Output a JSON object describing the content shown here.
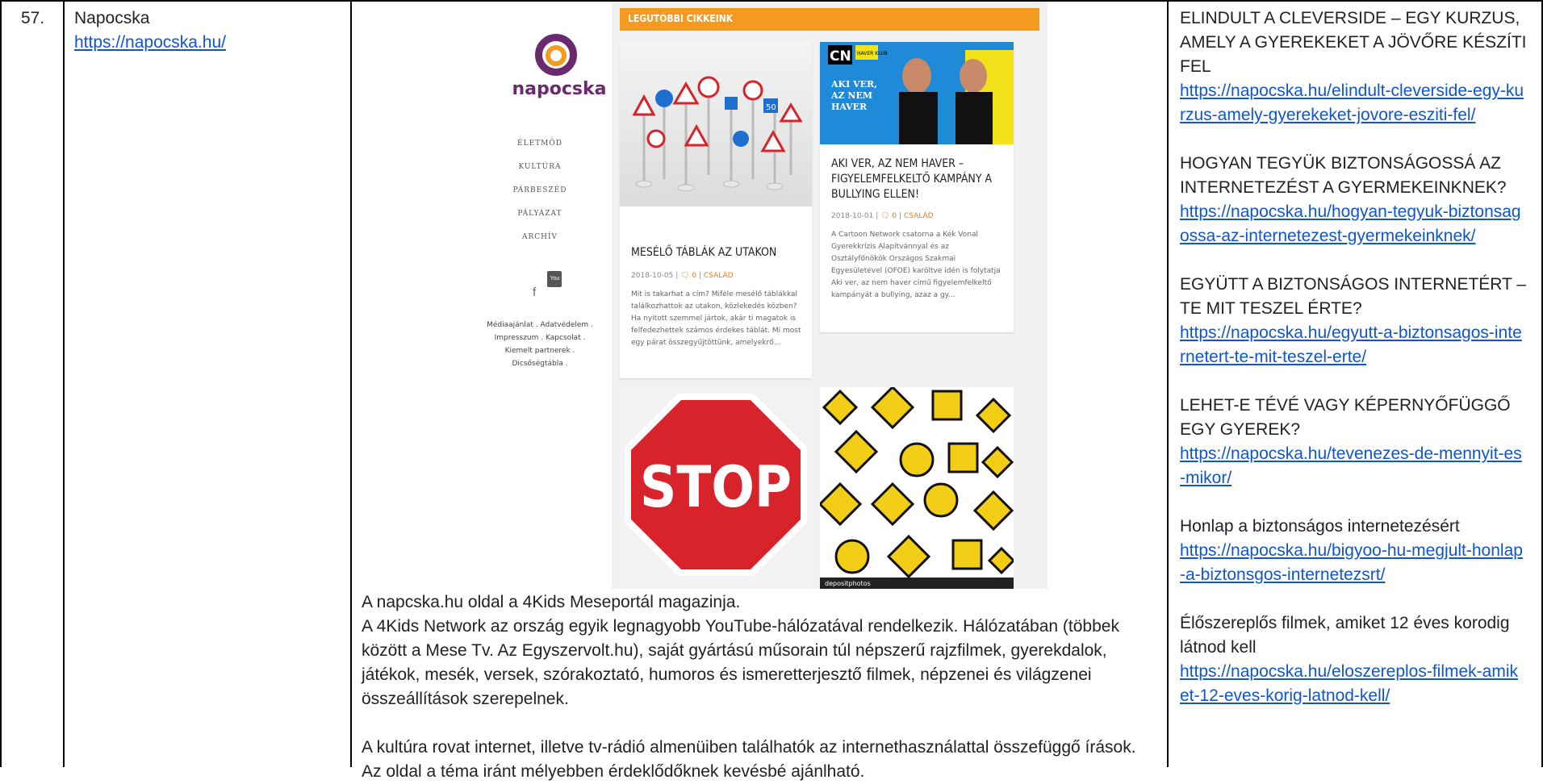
{
  "row": {
    "number": "57.",
    "site_name": "Napocska",
    "site_url": "https://napocska.hu/"
  },
  "screenshot": {
    "logo_text": "napocska",
    "menu": [
      "ÉLETMÓD",
      "KULTÚRA",
      "PÁRBESZÉD",
      "PÁLYÁZAT",
      "ARCHÍV"
    ],
    "social": {
      "facebook": "f",
      "youtube": "You Tube"
    },
    "footer_lines": [
      "Médiaajánlat . Adatvédelem .",
      "Impresszum . Kapcsolat .",
      "Kiemelt partnerek .",
      "Dicsőségtábla ."
    ],
    "section_title": "LEGUTÓBBI CIKKEINK",
    "cards": [
      {
        "title": "MESÉLŐ TÁBLÁK AZ UTAKON",
        "date": "2018-10-05",
        "comments": "0",
        "category": "CSALÁD",
        "excerpt": "Mit is takarhat a cím? Miféle mesélő táblákkal találkozhattok az utakon, közlekedés közben? Ha nyitott szemmel jártok, akár ti magatok is felfedezhettek számos érdekes táblát. Mi most egy párat összegyűjtöttünk, amelyekrő..."
      },
      {
        "title": "AKI VER, AZ NEM HAVER – FIGYELEMFELKELTŐ KAMPÁNY A BULLYING ELLEN!",
        "date": "2018-10-01",
        "comments": "0",
        "category": "CSALÁD",
        "excerpt": "A Cartoon Network csatorna a Kék Vonal Gyerekkrízis Alapítvánnyal és az Osztályfőnökök Országos Szakmai Egyesületével (OFOE) karöltve idén is folytatja Aki ver, az nem haver című figyelemfelkeltő kampányát a bullying, azaz a gy..."
      }
    ],
    "banner": {
      "cn_logo": "CN",
      "klub_label": "HAVER KLUB",
      "headline": "AKI VER, AZ NEM HAVER"
    },
    "stop_sign": "STOP",
    "stock_credit": "depositphotos"
  },
  "description": {
    "paragraph1": [
      "A napcska.hu oldal a 4Kids Meseportál magazinja.",
      "A 4Kids Network az ország egyik legnagyobb YouTube-hálózatával rendelkezik. Hálózatában (többek",
      "között a Mese Tv. Az Egyszervolt.hu), saját gyártású műsorain túl népszerű rajzfilmek, gyerekdalok,",
      "játékok, mesék, versek, szórakoztató, humoros és ismeretterjesztő filmek, népzenei és világzenei",
      "összeállítások szerepelnek."
    ],
    "paragraph2": [
      "A kultúra rovat internet, illetve tv-rádió almenüiben találhatók az internethasználattal összefüggő írások.",
      "Az oldal a téma iránt mélyebben érdeklődőknek kevésbé ajánlható."
    ]
  },
  "articles": [
    {
      "title": "ELINDULT A CLEVERSIDE – EGY KURZUS, AMELY A GYEREKEKET A JÖVŐRE KÉSZÍTI FEL",
      "url": "https://napocska.hu/elindult-cleverside-egy-kurzus-amely-gyerekeket-jovore-esziti-fel/"
    },
    {
      "title": "HOGYAN TEGYÜK BIZTONSÁGOSSÁ AZ INTERNETEZÉST A GYERMEKEINKNEK?",
      "url": "https://napocska.hu/hogyan-tegyuk-biztonsagossa-az-internetezest-gyermekeinknek/"
    },
    {
      "title": "EGYÜTT A BIZTONSÁGOS INTERNETÉRT – TE MIT TESZEL ÉRTE?",
      "url": "https://napocska.hu/egyutt-a-biztonsagos-internetert-te-mit-teszel-erte/"
    },
    {
      "title": "LEHET-E TÉVÉ VAGY KÉPERNYŐFÜGGŐ EGY GYEREK?",
      "url": "https://napocska.hu/tevenezes-de-mennyit-es-mikor/"
    },
    {
      "title": "Honlap a biztonságos internetezésért",
      "url": "https://napocska.hu/bigyoo-hu-megjult-honlap-a-biztonsgos-internetezsrt/"
    },
    {
      "title": "Élőszereplős filmek, amiket 12 éves korodig látnod kell",
      "url": "https://napocska.hu/eloszereplos-filmek-amiket-12-eves-korig-latnod-kell/"
    }
  ],
  "colors": {
    "link": "#1155cc",
    "accent_orange": "#f39a1f",
    "logo_purple": "#6a2a6e",
    "stop_red": "#d8232a",
    "sign_yellow": "#f2cd16"
  }
}
